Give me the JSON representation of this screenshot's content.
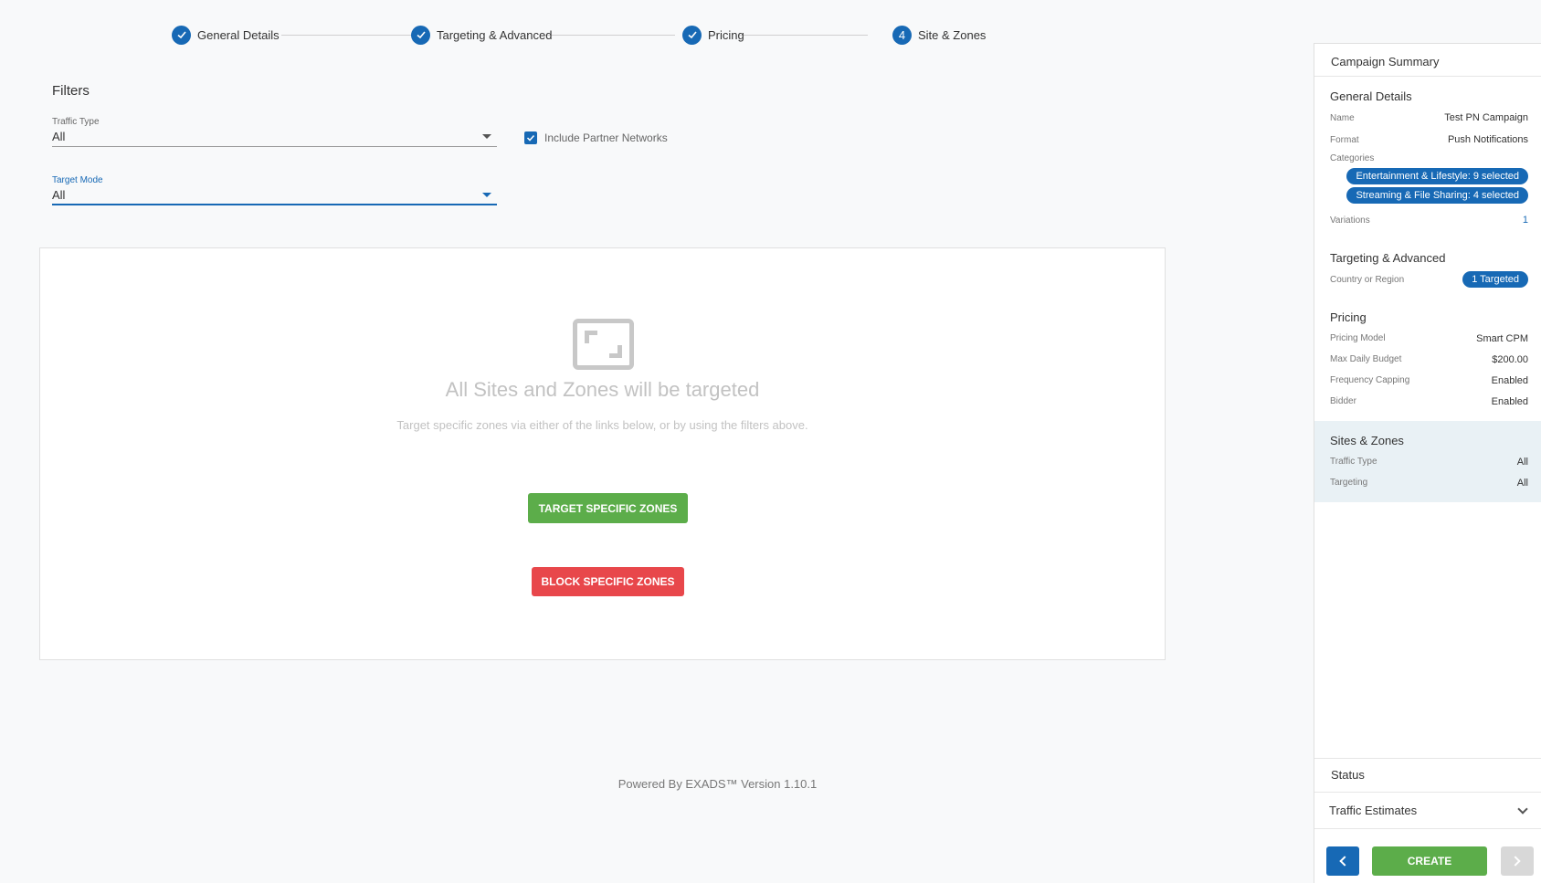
{
  "stepper": {
    "steps": [
      {
        "label": "General Details",
        "state": "done"
      },
      {
        "label": "Targeting & Advanced",
        "state": "done"
      },
      {
        "label": "Pricing",
        "state": "done"
      },
      {
        "label": "Site & Zones",
        "number": "4",
        "state": "current"
      }
    ]
  },
  "filters": {
    "title": "Filters",
    "traffic_type": {
      "label": "Traffic Type",
      "value": "All"
    },
    "target_mode": {
      "label": "Target Mode",
      "value": "All"
    },
    "include_partner": {
      "label": "Include Partner Networks",
      "checked": true
    }
  },
  "empty_state": {
    "title": "All Sites and Zones will be targeted",
    "subtitle": "Target specific zones via either of the links below, or by using the filters above.",
    "target_button": "TARGET SPECIFIC ZONES",
    "block_button": "BLOCK SPECIFIC ZONES"
  },
  "footer": "Powered By EXADS™ Version 1.10.1",
  "summary": {
    "title": "Campaign Summary",
    "general": {
      "title": "General Details",
      "name_key": "Name",
      "name_val": "Test PN Campaign",
      "format_key": "Format",
      "format_val": "Push Notifications",
      "categories_key": "Categories",
      "categories": [
        "Entertainment & Lifestyle: 9 selected",
        "Streaming & File Sharing: 4 selected"
      ],
      "variations_key": "Variations",
      "variations_val": "1"
    },
    "targeting": {
      "title": "Targeting & Advanced",
      "country_key": "Country or Region",
      "country_val": "1 Targeted"
    },
    "pricing": {
      "title": "Pricing",
      "model_key": "Pricing Model",
      "model_val": "Smart CPM",
      "budget_key": "Max Daily Budget",
      "budget_val": "$200.00",
      "freq_key": "Frequency Capping",
      "freq_val": "Enabled",
      "bidder_key": "Bidder",
      "bidder_val": "Enabled"
    },
    "sites": {
      "title": "Sites & Zones",
      "traffic_key": "Traffic Type",
      "traffic_val": "All",
      "targeting_key": "Targeting",
      "targeting_val": "All"
    },
    "status": "Status",
    "traffic_estimates": "Traffic Estimates",
    "create_button": "CREATE"
  },
  "colors": {
    "primary": "#1769b5",
    "success": "#5cad4a",
    "danger": "#e8474b"
  }
}
